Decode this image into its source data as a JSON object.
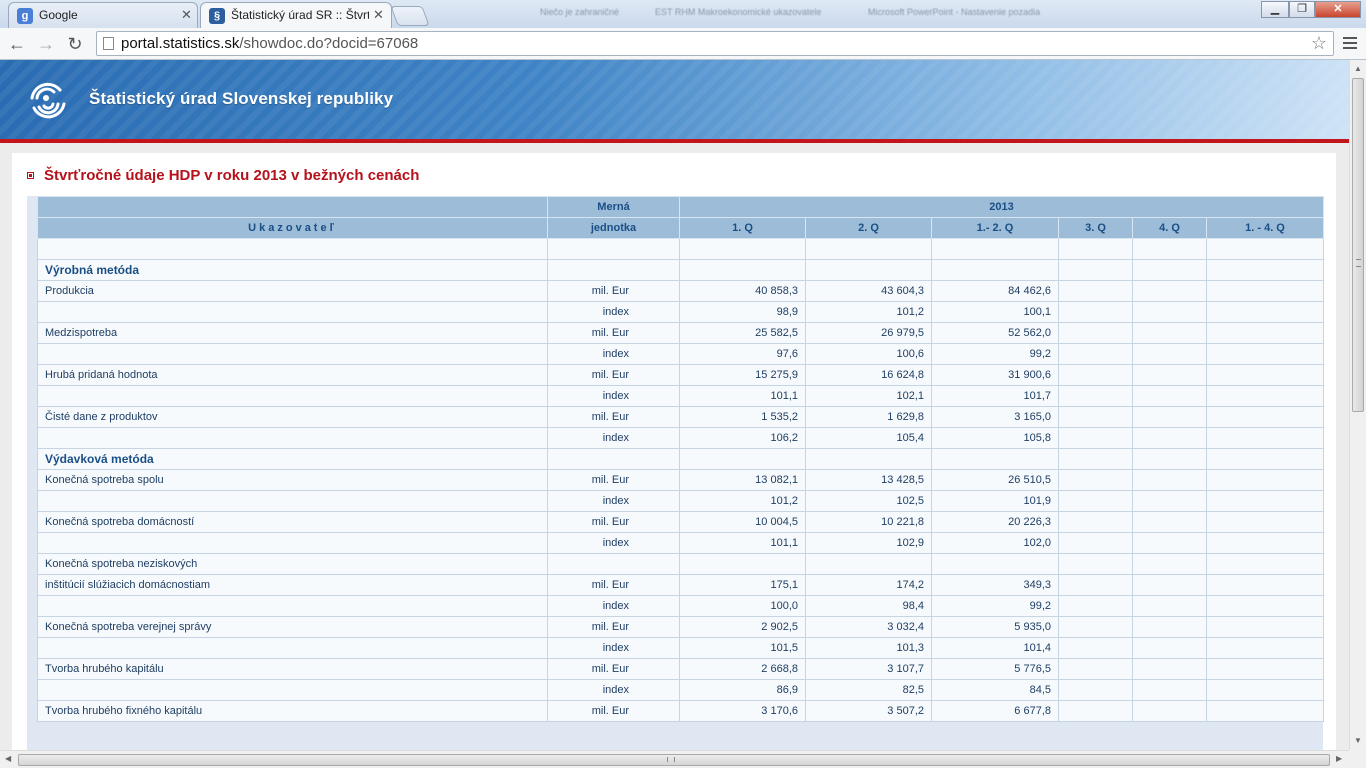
{
  "browser": {
    "tabs": [
      {
        "favicon": "google-g-icon",
        "title": "Google"
      },
      {
        "favicon": "susr-logo-icon",
        "title": "Štatistický úrad SR :: Štvrťr"
      }
    ],
    "background_windows": [
      "Niečo je zahraničné",
      "EST RHM Makroekonomické ukazovatele",
      "Microsoft PowerPoint - Nastavenie pozadia"
    ],
    "url": {
      "host": "portal.statistics.sk",
      "path": "/showdoc.do?docid=67068"
    }
  },
  "site": {
    "name": "Štatistický úrad Slovenskej republiky"
  },
  "page": {
    "title": "Štvrťročné údaje HDP v roku 2013 v bežných cenách"
  },
  "table": {
    "header_top": {
      "unit": "Merná",
      "year": "2013"
    },
    "header_sub": {
      "indicator": "Ukazovateľ",
      "unit": "jednotka",
      "periods": [
        "1. Q",
        "2. Q",
        "1.- 2. Q",
        "3. Q",
        "4. Q",
        "1. - 4. Q"
      ]
    },
    "rows": [
      {
        "label": "",
        "unit": "",
        "v": [
          "",
          "",
          "",
          "",
          "",
          ""
        ]
      },
      {
        "section": true,
        "label": "Výrobná metóda",
        "unit": "",
        "v": [
          "",
          "",
          "",
          "",
          "",
          ""
        ]
      },
      {
        "label": "Produkcia",
        "unit": "mil. Eur",
        "v": [
          "40 858,3",
          "43 604,3",
          "84 462,6",
          "",
          "",
          ""
        ]
      },
      {
        "label": "",
        "unit": "index",
        "v": [
          "98,9",
          "101,2",
          "100,1",
          "",
          "",
          ""
        ]
      },
      {
        "label": "Medzispotreba",
        "unit": "mil. Eur",
        "v": [
          "25 582,5",
          "26 979,5",
          "52 562,0",
          "",
          "",
          ""
        ]
      },
      {
        "label": "",
        "unit": "index",
        "v": [
          "97,6",
          "100,6",
          "99,2",
          "",
          "",
          ""
        ]
      },
      {
        "label": "Hrubá pridaná hodnota",
        "unit": "mil. Eur",
        "v": [
          "15 275,9",
          "16 624,8",
          "31 900,6",
          "",
          "",
          ""
        ]
      },
      {
        "label": "",
        "unit": "index",
        "v": [
          "101,1",
          "102,1",
          "101,7",
          "",
          "",
          ""
        ]
      },
      {
        "label": "Čisté dane z produktov",
        "unit": "mil. Eur",
        "v": [
          "1 535,2",
          "1 629,8",
          "3 165,0",
          "",
          "",
          ""
        ]
      },
      {
        "label": "",
        "unit": "index",
        "v": [
          "106,2",
          "105,4",
          "105,8",
          "",
          "",
          ""
        ]
      },
      {
        "section": true,
        "label": "Výdavková metóda",
        "unit": "",
        "v": [
          "",
          "",
          "",
          "",
          "",
          ""
        ]
      },
      {
        "label": "Konečná spotreba spolu",
        "unit": "mil. Eur",
        "v": [
          "13 082,1",
          "13 428,5",
          "26 510,5",
          "",
          "",
          ""
        ]
      },
      {
        "label": "",
        "unit": "index",
        "v": [
          "101,2",
          "102,5",
          "101,9",
          "",
          "",
          ""
        ]
      },
      {
        "label": "Konečná spotreba domácností",
        "unit": "mil. Eur",
        "v": [
          "10 004,5",
          "10 221,8",
          "20 226,3",
          "",
          "",
          ""
        ]
      },
      {
        "label": "",
        "unit": "index",
        "v": [
          "101,1",
          "102,9",
          "102,0",
          "",
          "",
          ""
        ]
      },
      {
        "label": "Konečná spotreba neziskových",
        "unit": "",
        "v": [
          "",
          "",
          "",
          "",
          "",
          ""
        ]
      },
      {
        "label": "inštitúcií slúžiacich domácnostiam",
        "unit": "mil. Eur",
        "v": [
          "175,1",
          "174,2",
          "349,3",
          "",
          "",
          ""
        ]
      },
      {
        "label": "",
        "unit": "index",
        "v": [
          "100,0",
          "98,4",
          "99,2",
          "",
          "",
          ""
        ]
      },
      {
        "label": "Konečná spotreba verejnej správy",
        "unit": "mil. Eur",
        "v": [
          "2 902,5",
          "3 032,4",
          "5 935,0",
          "",
          "",
          ""
        ]
      },
      {
        "label": "",
        "unit": "index",
        "v": [
          "101,5",
          "101,3",
          "101,4",
          "",
          "",
          ""
        ]
      },
      {
        "label": "Tvorba hrubého kapitálu",
        "unit": "mil. Eur",
        "v": [
          "2 668,8",
          "3 107,7",
          "5 776,5",
          "",
          "",
          ""
        ]
      },
      {
        "label": "",
        "unit": "index",
        "v": [
          "86,9",
          "82,5",
          "84,5",
          "",
          "",
          ""
        ]
      },
      {
        "label": "Tvorba hrubého fixného kapitálu",
        "unit": "mil. Eur",
        "v": [
          "3 170,6",
          "3 507,2",
          "6 677,8",
          "",
          "",
          ""
        ]
      }
    ]
  }
}
